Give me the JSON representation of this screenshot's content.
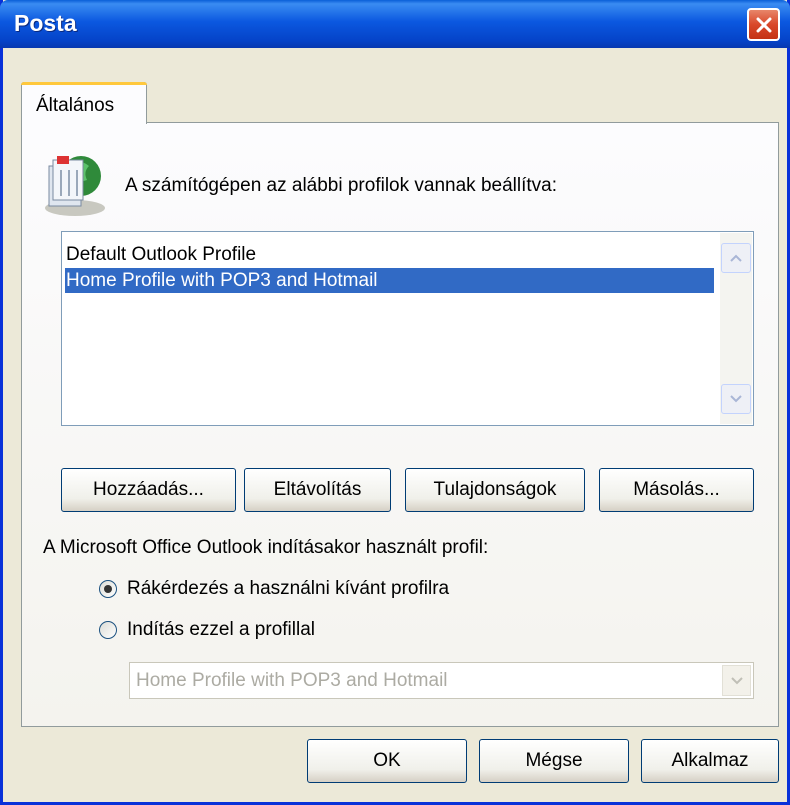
{
  "window": {
    "title": "Posta"
  },
  "tabs": [
    {
      "label": "Általános"
    }
  ],
  "intro_text": "A számítógépen az alábbi profilok vannak beállítva:",
  "profiles": {
    "items": [
      {
        "label": "Default Outlook Profile",
        "selected": false
      },
      {
        "label": "Home Profile with POP3 and Hotmail",
        "selected": true
      }
    ]
  },
  "profile_buttons": {
    "add": "Hozzáadás...",
    "remove": "Eltávolítás",
    "properties": "Tulajdonságok",
    "copy": "Másolás..."
  },
  "startup": {
    "label": "A Microsoft Office Outlook indításakor használt profil:",
    "options": [
      {
        "label": "Rákérdezés a használni kívánt profilra",
        "checked": true
      },
      {
        "label": "Indítás ezzel a profillal",
        "checked": false
      }
    ],
    "profile_select_value": "Home Profile with POP3 and Hotmail"
  },
  "dialog_buttons": {
    "ok": "OK",
    "cancel": "Mégse",
    "apply": "Alkalmaz"
  },
  "colors": {
    "selection": "#316ac5",
    "titlebar": "#0b58e0",
    "close": "#d9482a"
  }
}
